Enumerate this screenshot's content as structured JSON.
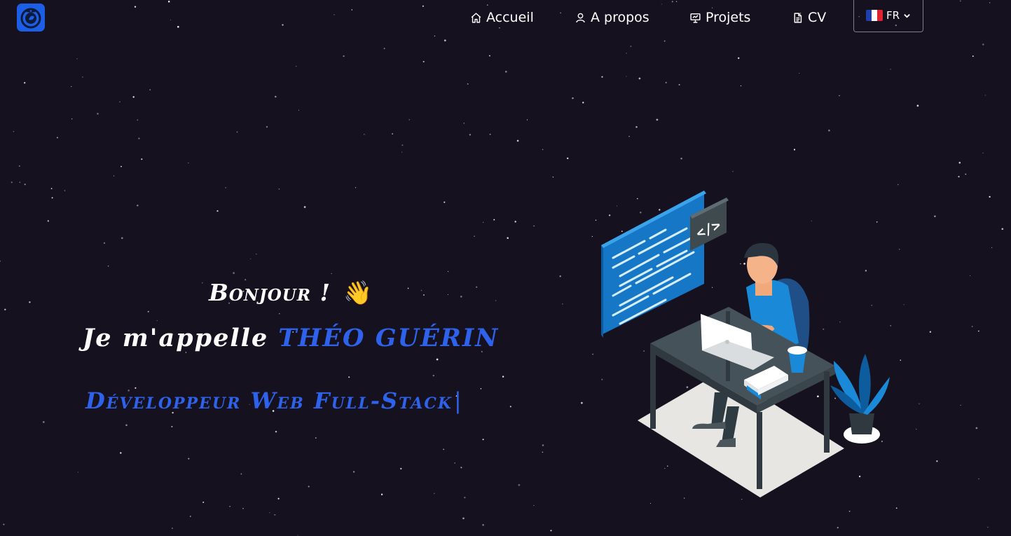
{
  "nav": {
    "items": [
      {
        "label": "Accueil",
        "icon": "home-icon"
      },
      {
        "label": "A propos",
        "icon": "user-icon"
      },
      {
        "label": "Projets",
        "icon": "presentation-icon"
      },
      {
        "label": "CV",
        "icon": "document-icon"
      }
    ],
    "language": "FR"
  },
  "hero": {
    "greeting": "Bonjour !",
    "wave_emoji": "👋",
    "intro": "Je m'appelle",
    "name": "Théo Guérin",
    "role": "Développeur Web Full-Stack",
    "cursor": "|"
  },
  "illustration": {
    "code_badge": "</>"
  },
  "colors": {
    "background": "#15111f",
    "accent": "#2f62ea",
    "logo": "#1c5fe6"
  }
}
